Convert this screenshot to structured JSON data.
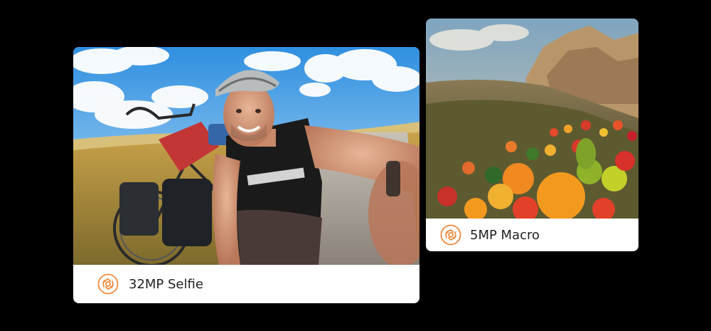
{
  "colors": {
    "background": "#000000",
    "card": "#ffffff",
    "accent": "#f08a3c",
    "text": "#222222"
  },
  "cards": [
    {
      "caption": "32MP Selfie",
      "icon": "camera-lens-icon",
      "photo_subject": "cyclist-selfie-photo"
    },
    {
      "caption": "5MP Macro",
      "icon": "camera-lens-icon",
      "photo_subject": "macro-fruit-landscape-photo"
    }
  ]
}
